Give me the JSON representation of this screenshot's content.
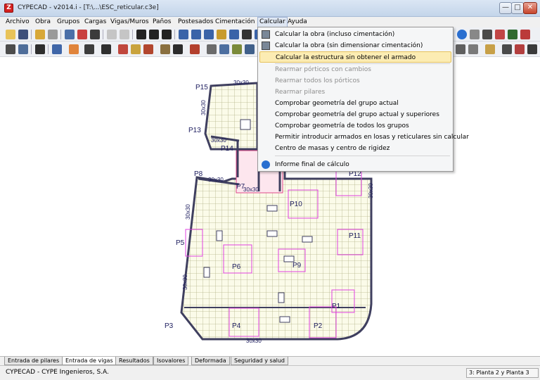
{
  "window": {
    "title": "CYPECAD - v2014.i - [T:\\...\\ESC_reticular.c3e]",
    "minimize": "—",
    "maximize": "□",
    "close": "✕"
  },
  "menubar": {
    "items": [
      "Archivo",
      "Obra",
      "Grupos",
      "Cargas",
      "Vigas/Muros",
      "Paños",
      "Postesados",
      "Cimentación",
      "Calcular",
      "Ayuda"
    ],
    "active": "Calcular"
  },
  "calc_menu": {
    "items": [
      {
        "label": "Calcular la obra (incluso cimentación)",
        "enabled": true,
        "icon": "calc-icon"
      },
      {
        "label": "Calcular la obra (sin dimensionar cimentación)",
        "enabled": true,
        "icon": "calc-icon"
      },
      {
        "label": "Calcular la estructura sin obtener el armado",
        "enabled": true,
        "highlighted": true
      },
      {
        "label": "Rearmar pórticos con cambios",
        "enabled": false
      },
      {
        "label": "Rearmar todos los pórticos",
        "enabled": false
      },
      {
        "label": "Rearmar pilares",
        "enabled": false
      },
      {
        "label": "Comprobar geometría del grupo actual",
        "enabled": true
      },
      {
        "label": "Comprobar geometría del grupo actual y superiores",
        "enabled": true
      },
      {
        "label": "Comprobar geometría de todos los grupos",
        "enabled": true
      },
      {
        "label": "Permitir introducir armados en losas y reticulares sin calcular",
        "enabled": true
      },
      {
        "label": "Centro de masas y centro de rigidez",
        "enabled": true
      },
      {
        "label": "Informe final de cálculo",
        "enabled": true,
        "icon": "info-icon"
      }
    ]
  },
  "plan": {
    "columns": [
      "P15",
      "P13",
      "P14",
      "P8",
      "P7",
      "P12",
      "P10",
      "P11",
      "P5",
      "P6",
      "P9",
      "P1",
      "P3",
      "P4",
      "P2"
    ],
    "dimension_label": "30x30"
  },
  "tabs": {
    "items": [
      "Entrada de pilares",
      "Entrada de vigas",
      "Resultados",
      "Isovalores",
      "Deformada",
      "Seguridad y salud"
    ],
    "active": "Entrada de vigas"
  },
  "status": {
    "company": "CYPECAD - CYPE Ingenieros, S.A.",
    "plant": "3: Planta 2 y Planta 3"
  },
  "colors": {
    "beam": "#5b5b7a",
    "grid": "#b3b38a",
    "slab_fill": "#fbfbe9",
    "abacus": "#e040e0",
    "menu_highlight": "#fcecb3"
  }
}
